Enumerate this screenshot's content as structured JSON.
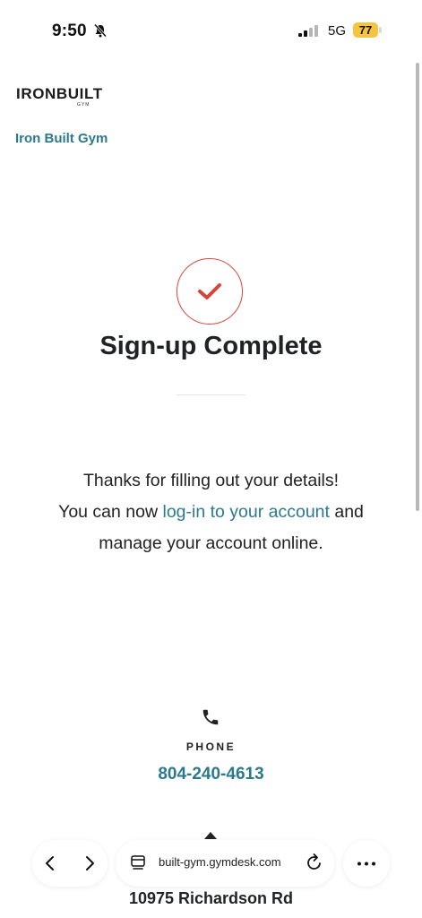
{
  "status_bar": {
    "time": "9:50",
    "network": "5G",
    "battery": "77"
  },
  "header": {
    "logo_text": "IRONBUILT",
    "logo_subtext": "GYM",
    "gym_name": "Iron Built Gym"
  },
  "main": {
    "title": "Sign-up Complete",
    "message_line1": "Thanks for filling out your details!",
    "message_line2_before": "You can now ",
    "message_link": "log-in to your account",
    "message_line2_after": " and",
    "message_line3": "manage your account online."
  },
  "contact": {
    "phone_label": "PHONE",
    "phone_number": "804-240-4613",
    "address": "10975 Richardson Rd"
  },
  "browser": {
    "url": "built-gym.gymdesk.com"
  },
  "colors": {
    "accent": "#2b7a8c",
    "check": "#d64538",
    "battery": "#f5c542"
  },
  "icons": [
    "bell-slash-icon",
    "signal-icon",
    "check-icon",
    "phone-icon",
    "back-icon",
    "forward-icon",
    "tabs-icon",
    "reload-icon",
    "more-icon",
    "caret-up-icon"
  ]
}
